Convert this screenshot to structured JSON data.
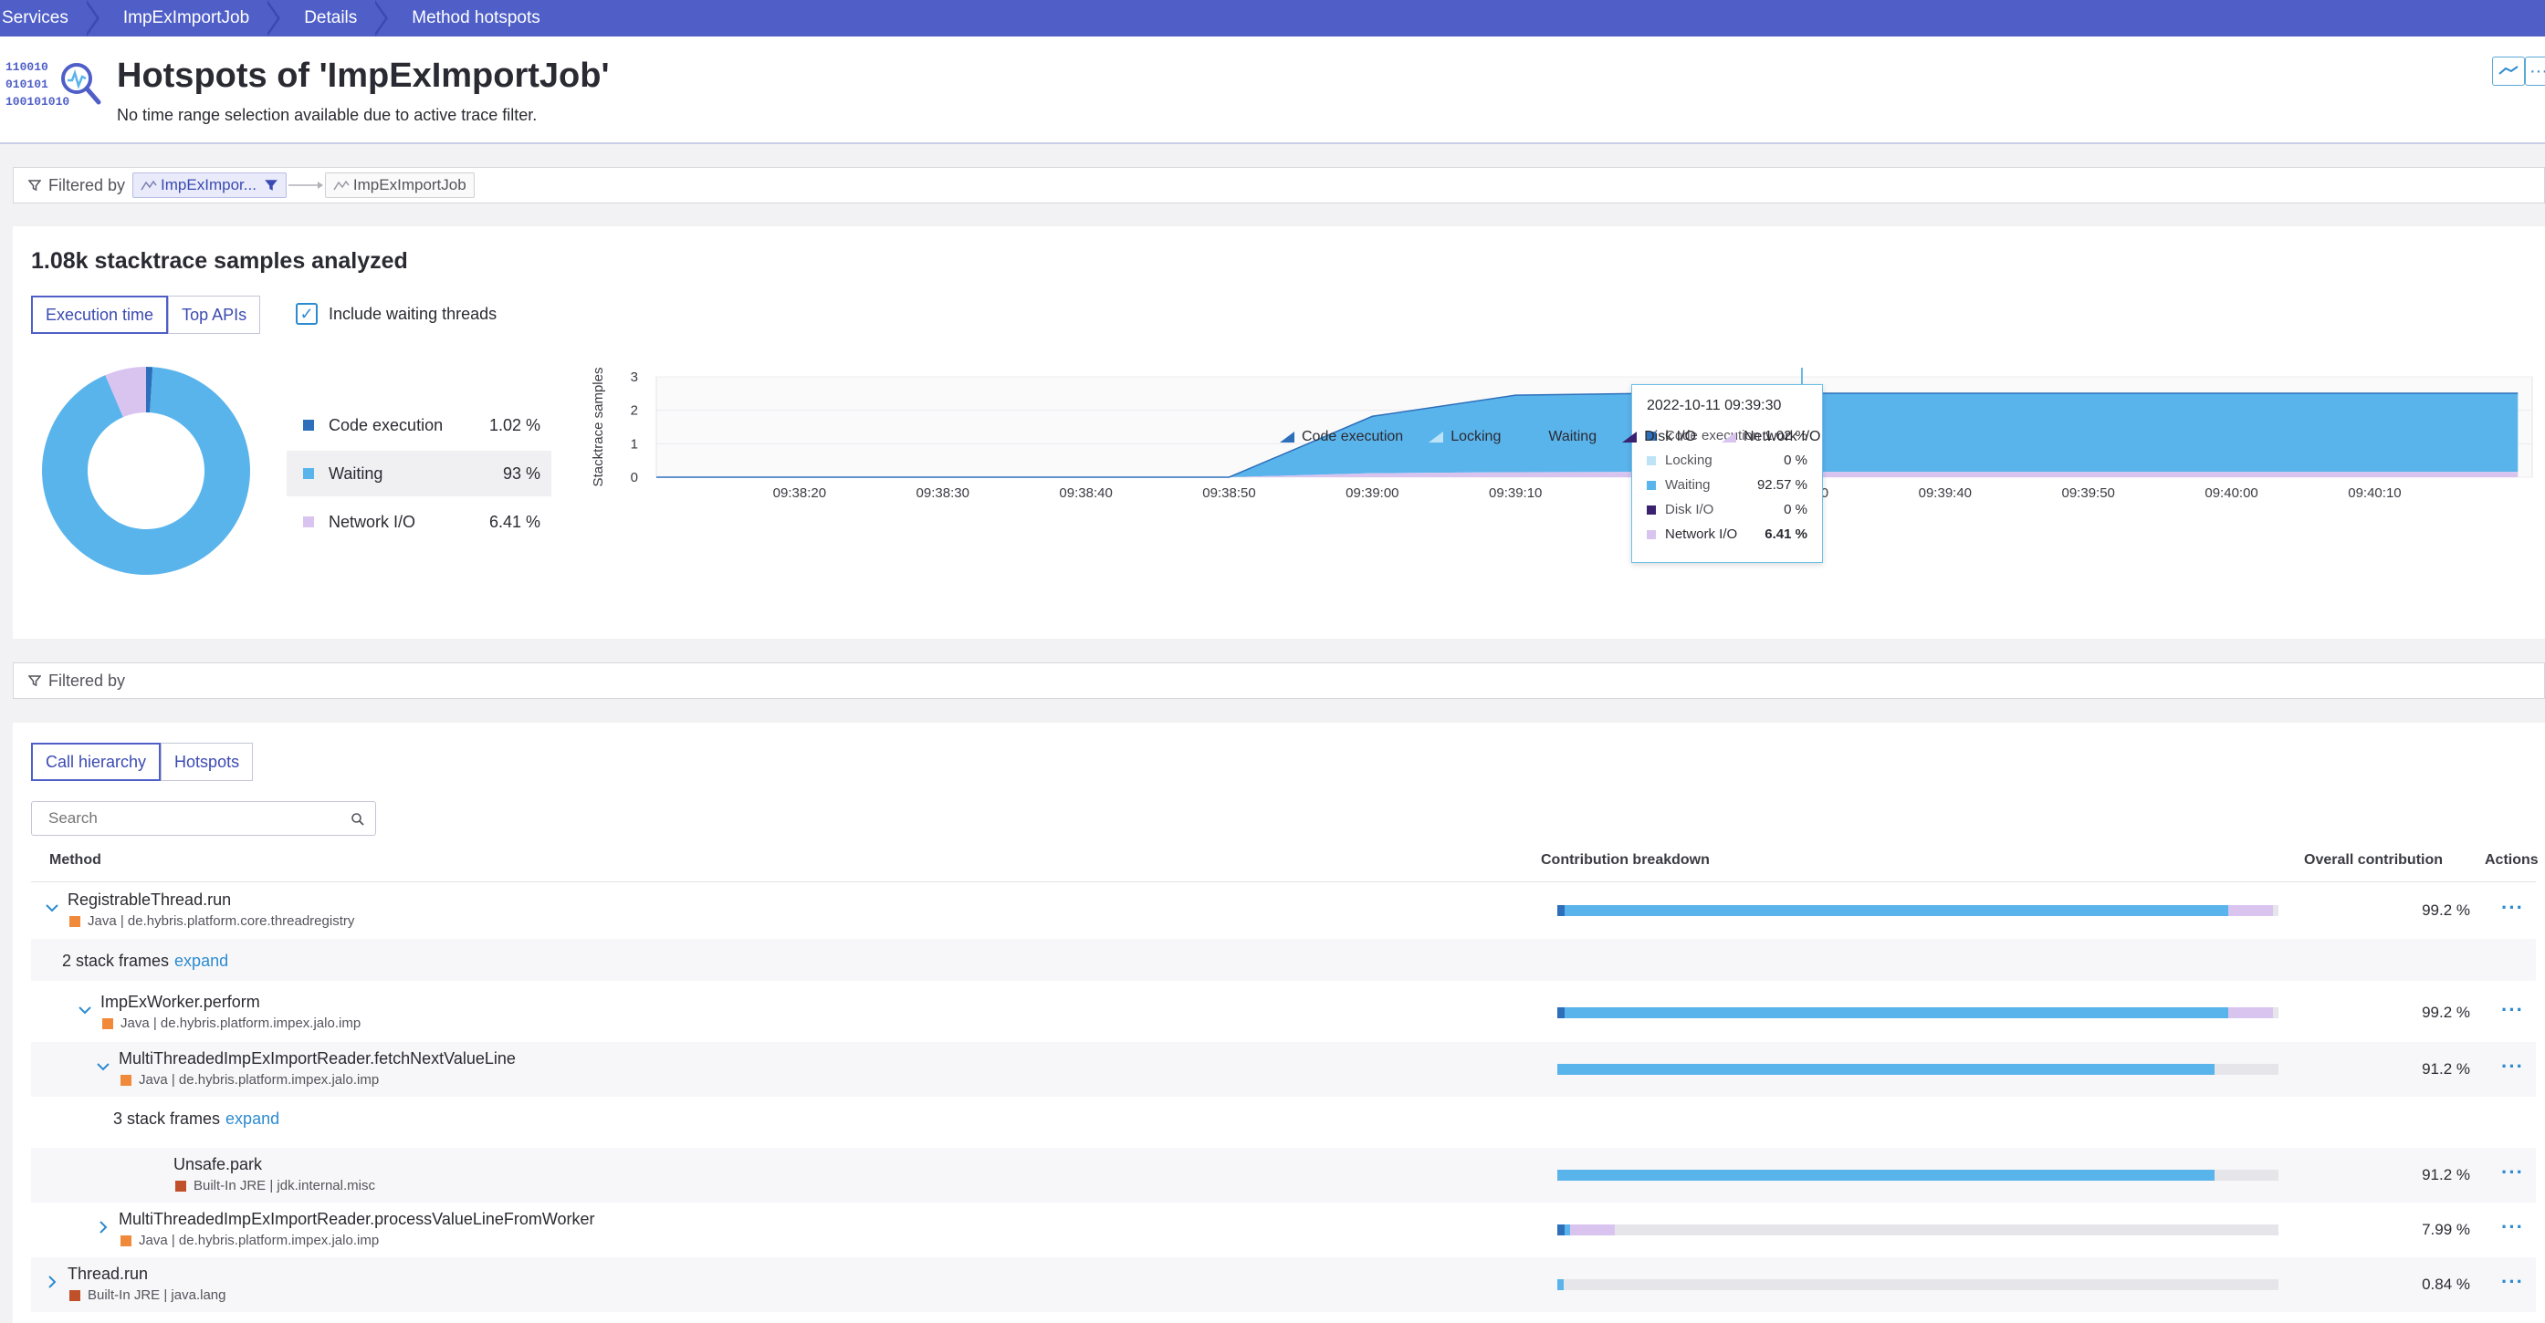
{
  "breadcrumb": [
    "Services",
    "ImpExImportJob",
    "Details",
    "Method hotspots"
  ],
  "header": {
    "icon_bits": [
      "110010",
      "010101",
      "100101010"
    ],
    "title": "Hotspots of 'ImpExImportJob'",
    "subtitle": "No time range selection available due to active trace filter.",
    "btn_more": "···"
  },
  "filter1": {
    "label": "Filtered by",
    "chip1": "ImpExImpor...",
    "chip2": "ImpExImportJob"
  },
  "filter2": {
    "label": "Filtered by"
  },
  "samples": {
    "title": "1.08k stacktrace samples analyzed",
    "tab_exec": "Execution time",
    "tab_apis": "Top APIs",
    "include_waiting": "Include waiting threads",
    "donut": [
      {
        "name": "Code execution",
        "value": "1.02 %",
        "pct": 1.02,
        "color": "#2d6fba"
      },
      {
        "name": "Waiting",
        "value": "93 %",
        "pct": 92.57,
        "color": "#5ab4ec"
      },
      {
        "name": "Network I/O",
        "value": "6.41 %",
        "pct": 6.41,
        "color": "#d9c4f0"
      }
    ]
  },
  "chart_data": {
    "type": "area",
    "ylabel": "Stacktrace samples",
    "ylim": [
      0,
      3
    ],
    "yticks": [
      0,
      1,
      2,
      3
    ],
    "xticks": [
      "09:38:20",
      "09:38:30",
      "09:38:40",
      "09:38:50",
      "09:39:00",
      "09:39:10",
      "09:39:20",
      "09:39:30",
      "09:39:40",
      "09:39:50",
      "09:40:00",
      "09:40:10"
    ],
    "x_seconds": [
      0,
      10,
      20,
      30,
      40,
      50,
      60,
      70,
      80,
      90,
      100,
      110,
      120
    ],
    "series": [
      {
        "name": "Code execution",
        "color": "#2d6fba",
        "values": [
          0,
          0,
          0,
          0,
          0,
          0,
          0,
          0,
          0,
          0,
          0,
          0,
          0
        ]
      },
      {
        "name": "Locking",
        "color": "#bde3f7",
        "values": [
          0,
          0,
          0,
          0,
          0,
          0,
          0,
          0,
          0,
          0,
          0,
          0,
          0
        ]
      },
      {
        "name": "Waiting",
        "color": "#5ab4ec",
        "values": [
          0,
          0,
          0,
          0,
          0,
          1.7,
          2.3,
          2.35,
          2.35,
          2.35,
          2.35,
          2.35,
          2.35
        ]
      },
      {
        "name": "Disk I/O",
        "color": "#3a2270",
        "values": [
          0,
          0,
          0,
          0,
          0,
          0,
          0,
          0,
          0,
          0,
          0,
          0,
          0
        ]
      },
      {
        "name": "Network I/O",
        "color": "#d9c4f0",
        "values": [
          0,
          0,
          0,
          0,
          0,
          0.12,
          0.15,
          0.16,
          0.16,
          0.16,
          0.16,
          0.16,
          0.16
        ]
      }
    ],
    "tooltip": {
      "time": "2022-10-11 09:39:30",
      "rows": [
        {
          "name": "Code execution",
          "value": "1.02 %",
          "color": "#2d6fba"
        },
        {
          "name": "Locking",
          "value": "0 %",
          "color": "#bde3f7"
        },
        {
          "name": "Waiting",
          "value": "92.57 %",
          "color": "#5ab4ec"
        },
        {
          "name": "Disk I/O",
          "value": "0 %",
          "color": "#3a2270"
        },
        {
          "name": "Network I/O",
          "value": "6.41 %",
          "color": "#d9c4f0"
        }
      ]
    }
  },
  "hierarchy": {
    "tab_call": "Call hierarchy",
    "tab_hot": "Hotspots",
    "search_placeholder": "Search",
    "col_method": "Method",
    "col_breakdown": "Contribution breakdown",
    "col_overall": "Overall contribution",
    "col_actions": "Actions",
    "actions_glyph": "···",
    "expand_label": "expand",
    "rows": [
      {
        "kind": "method",
        "name": "RegistrableThread.run",
        "sub": "Java | de.hybris.platform.core.threadregistry",
        "lang": "#f08a3a",
        "chev": "down",
        "pct": "99.2 %",
        "bar": [
          1.0,
          92.0,
          6.2
        ]
      },
      {
        "kind": "frames",
        "text": "2 stack frames"
      },
      {
        "kind": "method",
        "name": "ImpExWorker.perform",
        "sub": "Java | de.hybris.platform.impex.jalo.imp",
        "lang": "#f08a3a",
        "chev": "down",
        "pct": "99.2 %",
        "bar": [
          1.0,
          92.0,
          6.2
        ]
      },
      {
        "kind": "method",
        "name": "MultiThreadedImpExImportReader.fetchNextValueLine",
        "sub": "Java | de.hybris.platform.impex.jalo.imp",
        "lang": "#f08a3a",
        "chev": "down",
        "pct": "91.2 %",
        "bar": [
          0,
          91.2,
          0
        ]
      },
      {
        "kind": "frames",
        "text": "3 stack frames"
      },
      {
        "kind": "method",
        "name": "Unsafe.park",
        "sub": "Built-In JRE | jdk.internal.misc",
        "lang": "#c0502a",
        "chev": "",
        "pct": "91.2 %",
        "bar": [
          0,
          91.2,
          0
        ]
      },
      {
        "kind": "method",
        "name": "MultiThreadedImpExImportReader.processValueLineFromWorker",
        "sub": "Java | de.hybris.platform.impex.jalo.imp",
        "lang": "#f08a3a",
        "chev": "right",
        "pct": "7.99 %",
        "bar": [
          1.0,
          0.8,
          6.2
        ]
      },
      {
        "kind": "method",
        "name": "Thread.run",
        "sub": "Built-In JRE | java.lang",
        "lang": "#c0502a",
        "chev": "right",
        "pct": "0.84 %",
        "bar": [
          0,
          0.84,
          0
        ]
      }
    ]
  }
}
